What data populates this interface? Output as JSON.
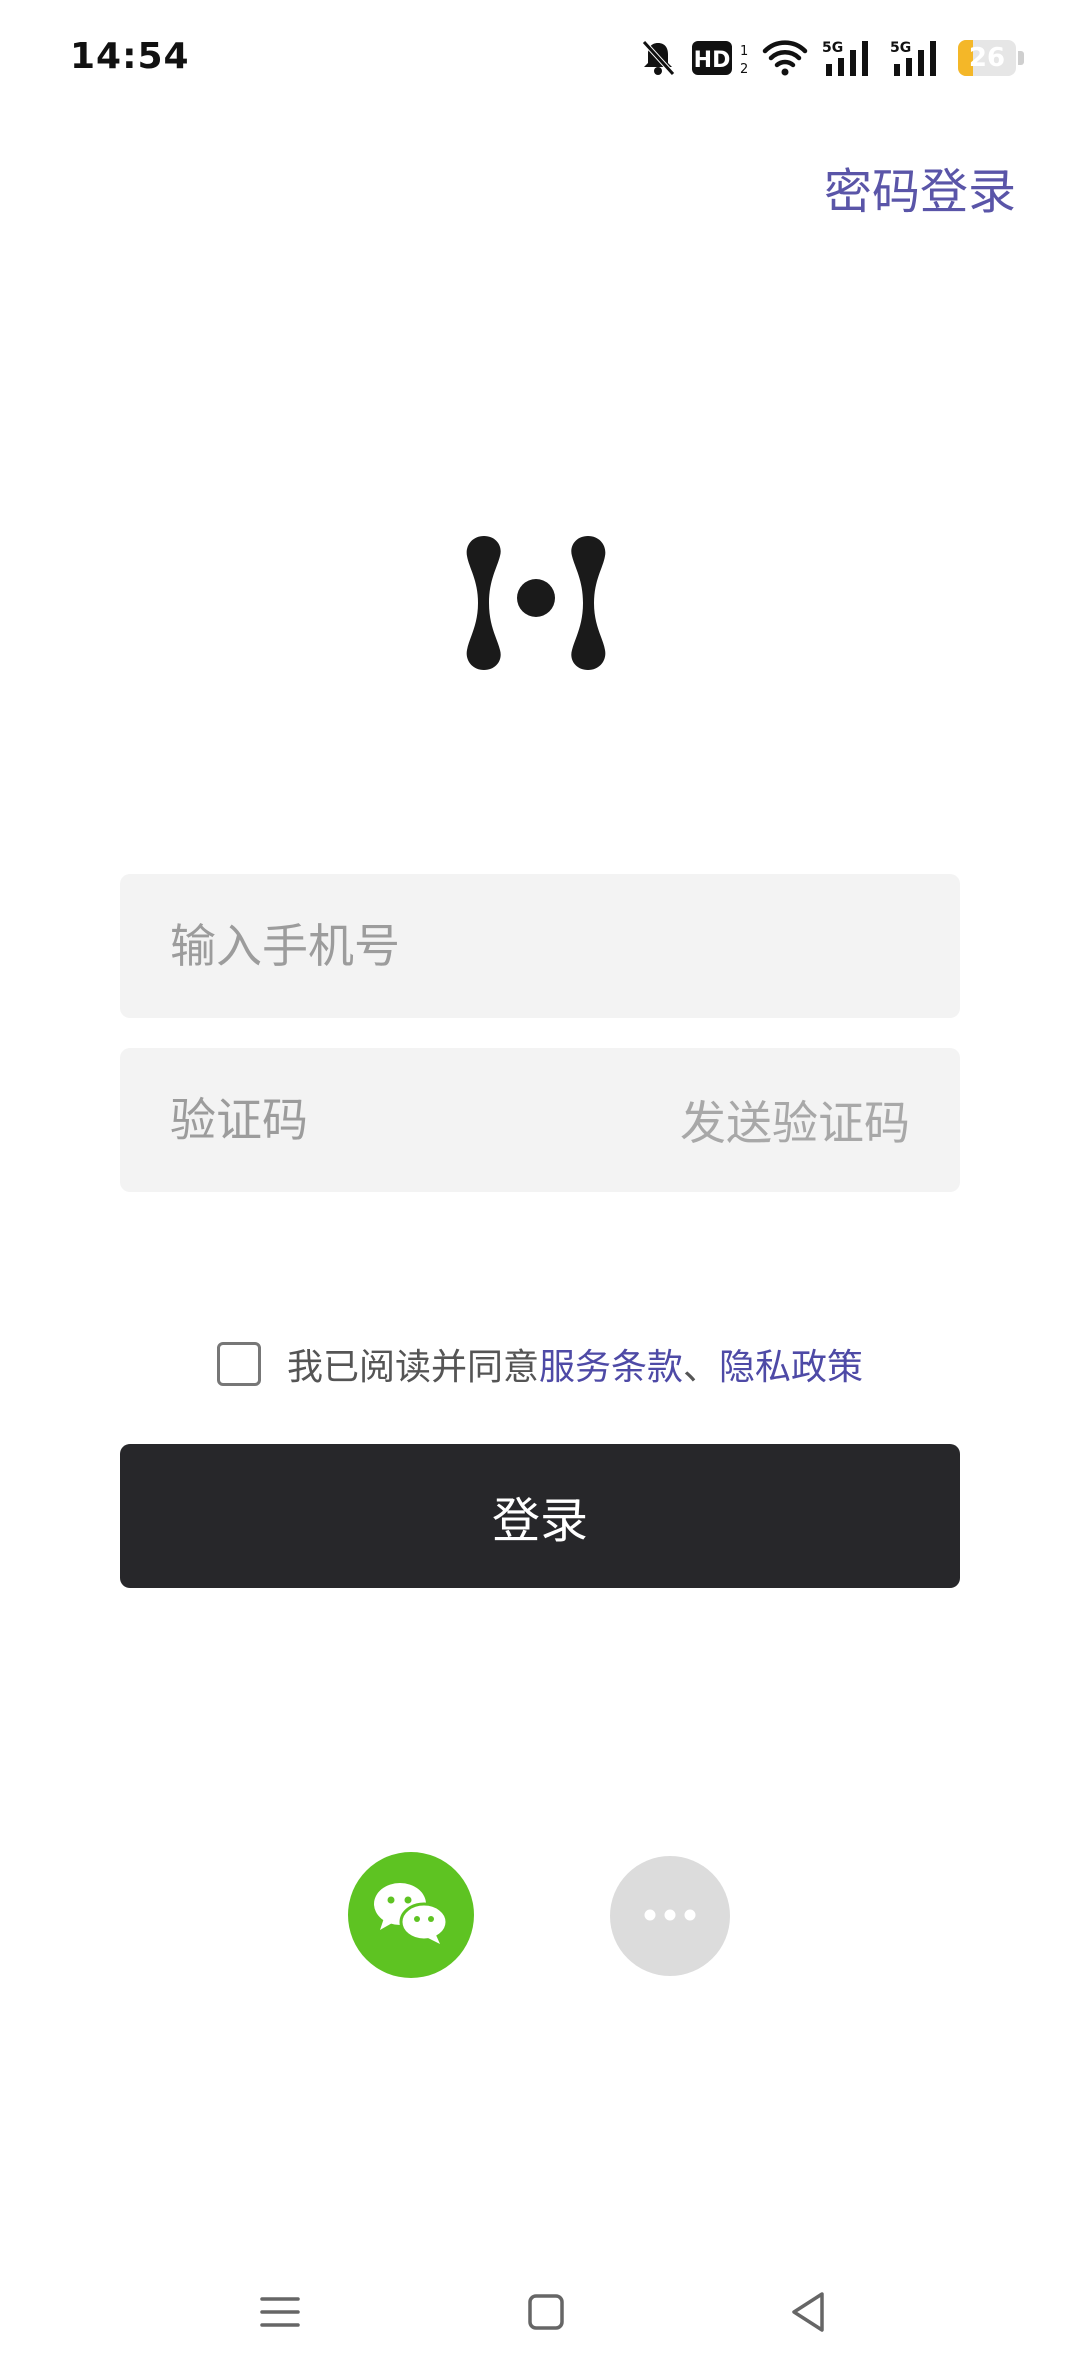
{
  "status_bar": {
    "time": "14:54",
    "battery_level": "26",
    "hd_label": "HD",
    "signal_1": "5G",
    "signal_2": "5G",
    "icons": [
      "bell-muted-icon",
      "hd-icon",
      "wifi-icon",
      "signal-5g-icon",
      "signal-5g-icon",
      "battery-icon"
    ]
  },
  "header": {
    "password_login": "密码登录"
  },
  "logo": {
    "icon": "app-logo-icon"
  },
  "form": {
    "phone_placeholder": "输入手机号",
    "code_placeholder": "验证码",
    "send_code": "发送验证码"
  },
  "agreement": {
    "prefix": "我已阅读并同意",
    "terms": "服务条款",
    "separator": "、",
    "privacy": "隐私政策",
    "checked": false
  },
  "login_button": "登录",
  "social": {
    "wechat_icon": "wechat-icon",
    "more_icon": "more-icon"
  },
  "nav": {
    "icons": [
      "menu-icon",
      "home-icon",
      "back-icon"
    ]
  },
  "colors": {
    "accent": "#5a55a8",
    "button": "#27272a",
    "wechat": "#5ec322",
    "field_bg": "#f3f3f3",
    "battery": "#f4b728"
  }
}
